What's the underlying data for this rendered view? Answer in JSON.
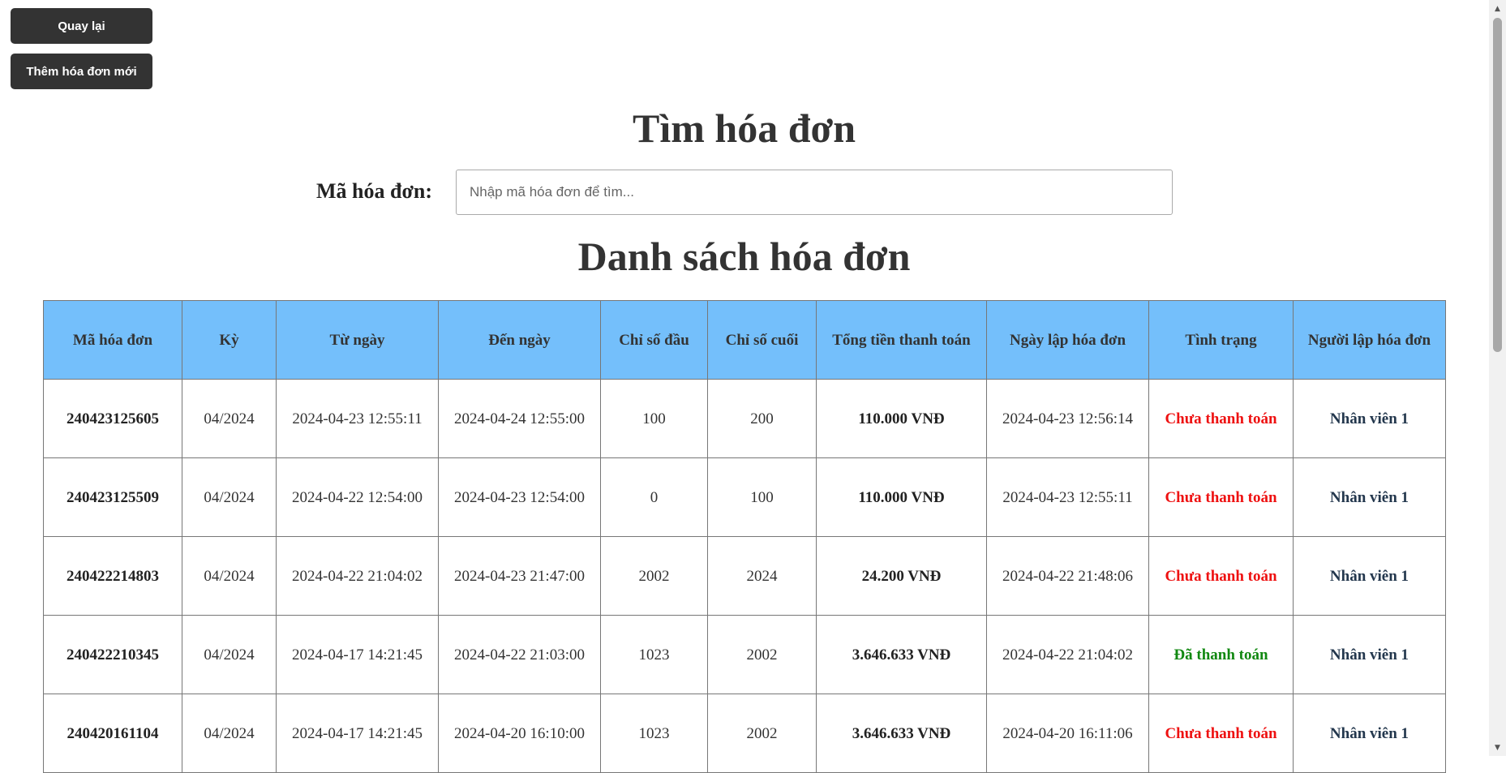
{
  "buttons": {
    "back": "Quay lại",
    "add": "Thêm hóa đơn mới"
  },
  "search": {
    "title": "Tìm hóa đơn",
    "label": "Mã hóa đơn:",
    "placeholder": "Nhập mã hóa đơn để tìm..."
  },
  "list": {
    "title": "Danh sách hóa đơn",
    "columns": [
      "Mã hóa đơn",
      "Kỳ",
      "Từ ngày",
      "Đến ngày",
      "Chỉ số đầu",
      "Chỉ số cuối",
      "Tổng tiền thanh toán",
      "Ngày lập hóa đơn",
      "Tình trạng",
      "Người lập hóa đơn"
    ],
    "rows": [
      {
        "id": "240423125605",
        "period": "04/2024",
        "from": "2024-04-23 12:55:11",
        "to": "2024-04-24 12:55:00",
        "start": "100",
        "end": "200",
        "total": "110.000 VNĐ",
        "created": "2024-04-23 12:56:14",
        "status": "Chưa thanh toán",
        "paid": false,
        "staff": "Nhân viên 1"
      },
      {
        "id": "240423125509",
        "period": "04/2024",
        "from": "2024-04-22 12:54:00",
        "to": "2024-04-23 12:54:00",
        "start": "0",
        "end": "100",
        "total": "110.000 VNĐ",
        "created": "2024-04-23 12:55:11",
        "status": "Chưa thanh toán",
        "paid": false,
        "staff": "Nhân viên 1"
      },
      {
        "id": "240422214803",
        "period": "04/2024",
        "from": "2024-04-22 21:04:02",
        "to": "2024-04-23 21:47:00",
        "start": "2002",
        "end": "2024",
        "total": "24.200 VNĐ",
        "created": "2024-04-22 21:48:06",
        "status": "Chưa thanh toán",
        "paid": false,
        "staff": "Nhân viên 1"
      },
      {
        "id": "240422210345",
        "period": "04/2024",
        "from": "2024-04-17 14:21:45",
        "to": "2024-04-22 21:03:00",
        "start": "1023",
        "end": "2002",
        "total": "3.646.633 VNĐ",
        "created": "2024-04-22 21:04:02",
        "status": "Đã thanh toán",
        "paid": true,
        "staff": "Nhân viên 1"
      },
      {
        "id": "240420161104",
        "period": "04/2024",
        "from": "2024-04-17 14:21:45",
        "to": "2024-04-20 16:10:00",
        "start": "1023",
        "end": "2002",
        "total": "3.646.633 VNĐ",
        "created": "2024-04-20 16:11:06",
        "status": "Chưa thanh toán",
        "paid": false,
        "staff": "Nhân viên 1"
      }
    ]
  },
  "colors": {
    "header_bg": "#74bffb",
    "unpaid": "#ee1111",
    "paid": "#118811",
    "button_bg": "#333333"
  },
  "icons": {
    "scroll_up": "scroll-up-arrow-icon",
    "scroll_down": "scroll-down-arrow-icon"
  }
}
